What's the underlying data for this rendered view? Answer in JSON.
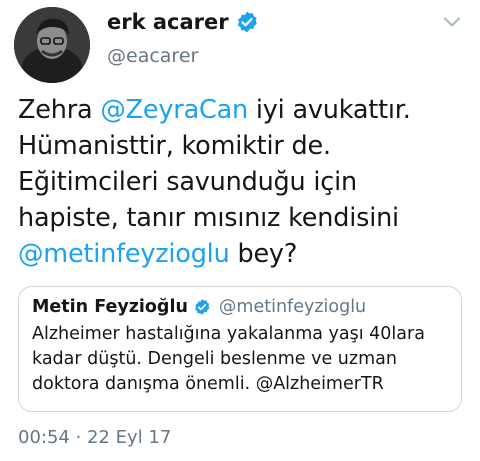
{
  "author": {
    "name": "erk acarer",
    "handle": "@eacarer",
    "verified_icon": "verified-badge-icon",
    "menu_icon": "chevron-down-icon"
  },
  "tweet": {
    "lines": [
      [
        {
          "text": "Zehra ",
          "mention": false
        },
        {
          "text": "@ZeyraCan",
          "mention": true
        },
        {
          "text": " iyi avukattır.",
          "mention": false
        }
      ],
      [
        {
          "text": "Hümanisttir, komiktir de.",
          "mention": false
        }
      ],
      [
        {
          "text": "Eğitimcileri savunduğu için",
          "mention": false
        }
      ],
      [
        {
          "text": "hapiste, tanır mısınız kendisini",
          "mention": false
        }
      ],
      [
        {
          "text": "@metinfeyzioglu",
          "mention": true
        },
        {
          "text": " bey?",
          "mention": false
        }
      ]
    ]
  },
  "quoted": {
    "name": "Metin Feyzioğlu",
    "handle": "@metinfeyzioglu",
    "lines": [
      "Alzheimer hastalığına yakalanma yaşı 40lara",
      "kadar düştü. Dengeli beslenme ve uzman",
      "doktora danışma önemli. @AlzheimerTR"
    ]
  },
  "timestamp": "00:54 · 22 Eyl 17",
  "colors": {
    "link": "#1da1f2",
    "secondary": "#657786",
    "border": "#ccd6dd"
  }
}
